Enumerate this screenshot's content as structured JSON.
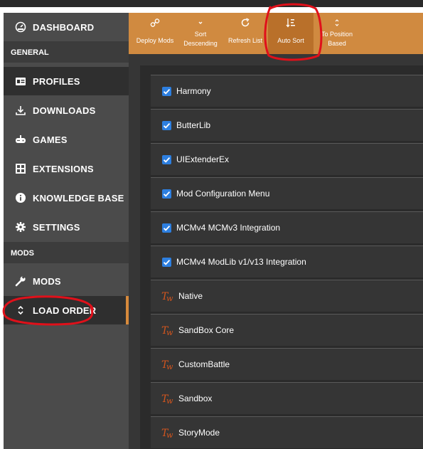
{
  "sidebar": {
    "dashboard": "DASHBOARD",
    "section_general": "GENERAL",
    "profiles": "PROFILES",
    "downloads": "DOWNLOADS",
    "games": "GAMES",
    "extensions": "EXTENSIONS",
    "knowledge_base": "KNOWLEDGE BASE",
    "settings": "SETTINGS",
    "section_mods": "MODS",
    "mods": "MODS",
    "load_order": "LOAD ORDER"
  },
  "toolbar": {
    "deploy_mods": "Deploy Mods",
    "sort_descending_1": "Sort",
    "sort_descending_2": "Descending",
    "refresh_list": "Refresh List",
    "auto_sort": "Auto Sort",
    "to_position_1": "To Position",
    "to_position_2": "Based"
  },
  "load_order": {
    "items": [
      {
        "name": "Harmony",
        "enabled": true
      },
      {
        "name": "ButterLib",
        "enabled": true
      },
      {
        "name": "UIExtenderEx",
        "enabled": true
      },
      {
        "name": "Mod Configuration Menu",
        "enabled": true
      },
      {
        "name": "MCMv4 MCMv3 Integration",
        "enabled": true
      },
      {
        "name": "MCMv4 ModLib v1/v13 Integration",
        "enabled": true
      },
      {
        "name": "Native",
        "native": true
      },
      {
        "name": "SandBox Core",
        "native": true
      },
      {
        "name": "CustomBattle",
        "native": true
      },
      {
        "name": "Sandbox",
        "native": true
      },
      {
        "name": "StoryMode",
        "native": true
      }
    ]
  },
  "colors": {
    "accent": "#d08a40",
    "checkbox": "#2d7fe0",
    "annotation": "#e0101a"
  }
}
